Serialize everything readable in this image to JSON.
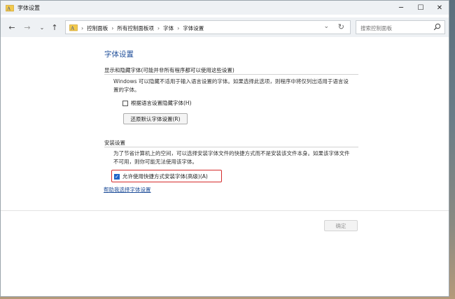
{
  "window": {
    "title": "字体设置"
  },
  "nav": {
    "back_icon": "back-arrow-icon",
    "forward_icon": "forward-arrow-icon",
    "recent_icon": "chevron-down-icon",
    "up_icon": "up-arrow-icon"
  },
  "address": {
    "crumbs": [
      "控制面板",
      "所有控制面板项",
      "字体",
      "字体设置"
    ]
  },
  "search": {
    "placeholder": "搜索控制面板"
  },
  "main": {
    "page_title": "字体设置",
    "section1": {
      "title": "显示和隐藏字体(可能并非所有程序都可以使用这些设置)",
      "desc_line1": "Windows 可以隐藏不适用于输入语言设置的字体。如果选择此选项，则程序中将仅列出适用于语言设",
      "desc_line2": "置的字体。",
      "checkbox_label": "根据语言设置隐藏字体(H)",
      "checkbox_checked": false,
      "restore_button": "还原默认字体设置(R)"
    },
    "section2": {
      "title": "安装设置",
      "desc_line1": "为了节省计算机上的空间，可以选择安装字体文件的快捷方式而不是安装该文件本身。如果该字体文件",
      "desc_line2": "不可用，则你可能无法使用该字体。",
      "checkbox_label": "允许使用快捷方式安装字体(高级)(A)",
      "checkbox_checked": true
    },
    "help_link": "帮助我选择字体设置"
  },
  "footer": {
    "ok_button": "确定"
  },
  "colors": {
    "title_blue": "#1f4e99",
    "highlight_red": "#d52b2b",
    "checkbox_blue": "#1f64c8"
  }
}
